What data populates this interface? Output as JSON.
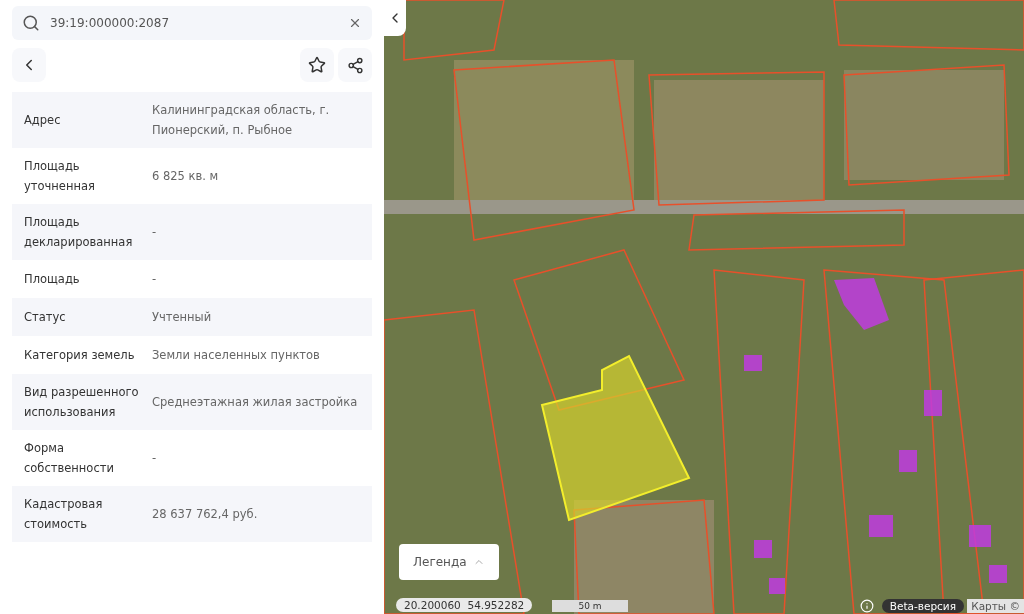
{
  "search": {
    "value": "39:19:000000:2087"
  },
  "properties": [
    {
      "label": "Адрес",
      "value": "Калининградская область, г. Пионерский, п. Рыбное"
    },
    {
      "label": "Площадь уточненная",
      "value": "6 825 кв. м"
    },
    {
      "label": "Площадь декларированная",
      "value": "-"
    },
    {
      "label": "Площадь",
      "value": "-"
    },
    {
      "label": "Статус",
      "value": "Учтенный"
    },
    {
      "label": "Категория земель",
      "value": "Земли населенных пунктов"
    },
    {
      "label": "Вид разрешенного использования",
      "value": "Среднеэтажная жилая застройка"
    },
    {
      "label": "Форма собственности",
      "value": "-"
    },
    {
      "label": "Кадастровая стоимость",
      "value": "28 637 762,4 руб."
    }
  ],
  "map": {
    "legend": "Легенда",
    "longitude": "20.200060",
    "latitude": "54.952282",
    "scale": "50 m",
    "beta": "Beta-версия",
    "attribution": "Карты ©"
  }
}
